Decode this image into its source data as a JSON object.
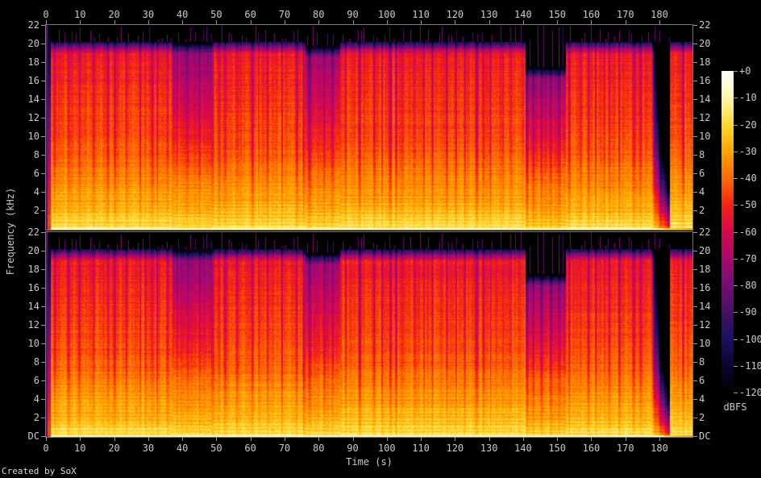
{
  "credit": "Created by SoX",
  "chart_data": {
    "type": "heatmap",
    "subtype": "stereo-audio-spectrogram",
    "channels": 2,
    "title": "",
    "xlabel": "Time (s)",
    "ylabel": "Frequency (kHz)",
    "x_ticks_s": [
      0,
      10,
      20,
      30,
      40,
      50,
      60,
      70,
      80,
      90,
      100,
      110,
      120,
      130,
      140,
      150,
      160,
      170,
      180
    ],
    "x_range_s": [
      0,
      189.7
    ],
    "y_range_khz": [
      0,
      22
    ],
    "freq_ticks": [
      {
        "khz": 22,
        "label": "22"
      },
      {
        "khz": 20,
        "label": "20"
      },
      {
        "khz": 18,
        "label": "18"
      },
      {
        "khz": 16,
        "label": "16"
      },
      {
        "khz": 14,
        "label": "14"
      },
      {
        "khz": 12,
        "label": "12"
      },
      {
        "khz": 10,
        "label": "10"
      },
      {
        "khz": 8,
        "label": "8"
      },
      {
        "khz": 6,
        "label": "6"
      },
      {
        "khz": 4,
        "label": "4"
      },
      {
        "khz": 2,
        "label": "2"
      }
    ],
    "dc_tick_label": "DC",
    "grid": false,
    "colorbar": {
      "label": "dBFS",
      "range_db": [
        0,
        -120
      ],
      "tick_labels": [
        "+0",
        "-10",
        "-20",
        "-30",
        "-40",
        "-50",
        "-60",
        "-70",
        "-80",
        "-90",
        "-100",
        "-110",
        "-120"
      ],
      "palette_top_to_bottom": [
        "#ffffff",
        "#fff6ad",
        "#ffd930",
        "#ffa400",
        "#ff6a00",
        "#f52411",
        "#d8074f",
        "#a9086f",
        "#750d78",
        "#451264",
        "#1c1060",
        "#0a0533",
        "#000000"
      ]
    },
    "audio": {
      "duration_s": 189.7,
      "lowpass_cutoff_khz": 20.2,
      "dc_line_db": -11,
      "noise_db": 4.5,
      "base_spectrum_db": [
        [
          0,
          -11
        ],
        [
          0.3,
          -17
        ],
        [
          1,
          -21
        ],
        [
          2,
          -26
        ],
        [
          4,
          -31
        ],
        [
          6,
          -36
        ],
        [
          8,
          -41
        ],
        [
          10,
          -44
        ],
        [
          12,
          -46
        ],
        [
          14,
          -48
        ],
        [
          16,
          -50
        ],
        [
          18,
          -52
        ],
        [
          19.5,
          -54
        ],
        [
          22,
          -57
        ]
      ],
      "sections": [
        {
          "t0": 0,
          "t1": 1.3,
          "type": "intro"
        },
        {
          "t0": 1.3,
          "t1": 37,
          "gain": 0,
          "hf": 0,
          "cutoff": 20.2
        },
        {
          "t0": 37,
          "t1": 48.5,
          "gain": -2,
          "hf": -20,
          "cutoff": 20.2
        },
        {
          "t0": 48.5,
          "t1": 76,
          "gain": 0,
          "hf": 0,
          "cutoff": 20.2
        },
        {
          "t0": 76,
          "t1": 86.3,
          "gain": -2,
          "hf": -18,
          "cutoff": 19.8
        },
        {
          "t0": 86.3,
          "t1": 140.5,
          "gain": 0,
          "hf": 0,
          "cutoff": 20.2
        },
        {
          "t0": 140.5,
          "t1": 152.5,
          "gain": -4,
          "hf": -24,
          "cutoff": 17.5
        },
        {
          "t0": 152.5,
          "t1": 177.5,
          "gain": 0,
          "hf": 0,
          "cutoff": 20.2
        },
        {
          "t0": 177.5,
          "t1": 183,
          "type": "decay",
          "gain": 0,
          "hf": 0,
          "cutoff": 20.2
        },
        {
          "t0": 183,
          "t1": 189.7,
          "type": "tail",
          "cutoff": 20.2
        }
      ],
      "beat_gap_seed": 42,
      "spike_seed": 1337,
      "channel_seeds": [
        3,
        11
      ]
    }
  }
}
